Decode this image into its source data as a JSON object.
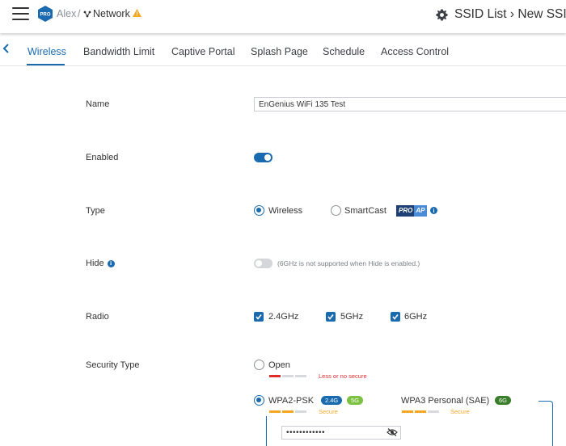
{
  "header": {
    "breadcrumb_org": "Alex",
    "breadcrumb_sep": "/",
    "breadcrumb_network": "Network",
    "pro_badge": "PRO",
    "page_title": "SSID List › New SSID"
  },
  "tabs": [
    {
      "label": "Wireless",
      "active": true
    },
    {
      "label": "Bandwidth Limit"
    },
    {
      "label": "Captive Portal"
    },
    {
      "label": "Splash Page"
    },
    {
      "label": "Schedule"
    },
    {
      "label": "Access Control"
    }
  ],
  "form": {
    "name": {
      "label": "Name",
      "value": "EnGenius WiFi 135 Test"
    },
    "enabled": {
      "label": "Enabled",
      "value": true
    },
    "type": {
      "label": "Type",
      "options": [
        "Wireless",
        "SmartCast"
      ],
      "selected": "Wireless",
      "pro_ap_badge": [
        "PRO",
        "AP"
      ]
    },
    "hide": {
      "label": "Hide",
      "value": false,
      "note": "(6GHz is not supported when Hide is enabled.)"
    },
    "radio": {
      "label": "Radio",
      "bands": [
        "2.4GHz",
        "5GHz",
        "6GHz"
      ],
      "checked": [
        true,
        true,
        true
      ]
    },
    "security": {
      "label": "Security Type",
      "options": [
        {
          "name": "Open",
          "strength_text": "Less or no secure",
          "strength_color": "#e02b2b",
          "level": 1
        },
        {
          "name": "WPA2-PSK",
          "badges": [
            "2.4G",
            "5G"
          ],
          "strength_text": "Secure",
          "strength_color": "#f5a623",
          "level": 3,
          "selected": true
        },
        {
          "name": "WPA3 Personal (SAE)",
          "badges": [
            "6G"
          ],
          "strength_text": "Secure",
          "strength_color": "#f5a623",
          "level": 3
        }
      ],
      "password_value": "••••••••••••"
    }
  },
  "colors": {
    "accent": "#1a6ab0",
    "badge_24g": "#1a6ab0",
    "badge_5g": "#7cc242",
    "badge_6g": "#3a7d2a",
    "warning": "#f5a623"
  }
}
